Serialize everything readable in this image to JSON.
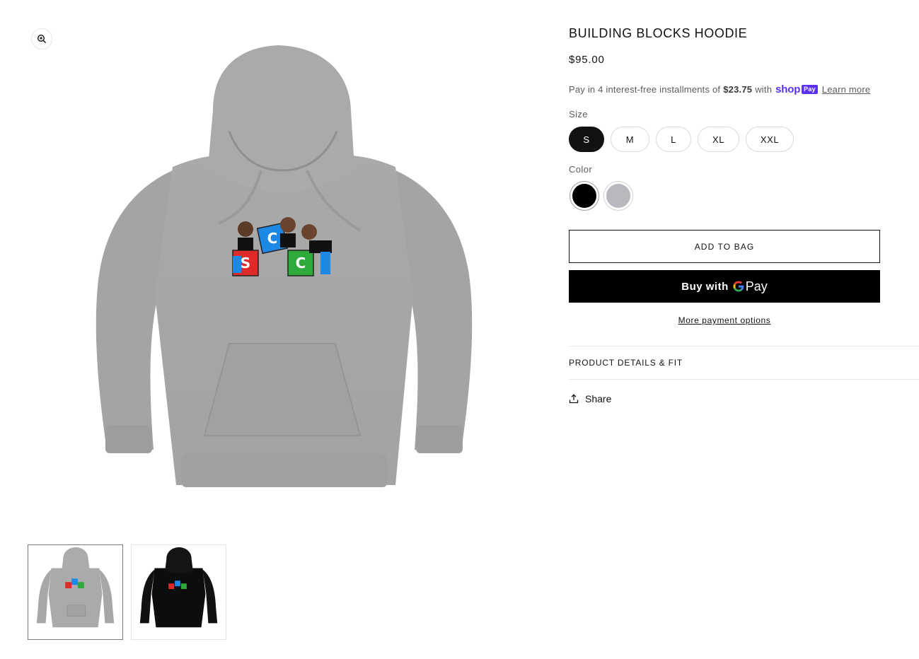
{
  "product": {
    "title": "BUILDING BLOCKS HOODIE",
    "price": "$95.00"
  },
  "installments": {
    "prefix": "Pay in 4 interest-free installments of",
    "amount": "$23.75",
    "with_text": "with",
    "shop_word": "shop",
    "pay_word": "Pay",
    "learn_more": "Learn more"
  },
  "options": {
    "size_label": "Size",
    "sizes": [
      "S",
      "M",
      "L",
      "XL",
      "XXL"
    ],
    "selected_size": "S",
    "color_label": "Color",
    "colors": [
      {
        "name": "black",
        "hex": "#000000"
      },
      {
        "name": "gray",
        "hex": "#B8B8BE"
      }
    ]
  },
  "design_letters": [
    "C",
    "C",
    "S",
    "C"
  ],
  "buttons": {
    "add_to_bag": "ADD TO BAG",
    "buy_with": "Buy with",
    "gpay_g": "G",
    "gpay_pay": "Pay",
    "more_payment_options": "More payment options"
  },
  "accordion": {
    "details_label": "PRODUCT DETAILS & FIT"
  },
  "share_label": "Share",
  "colors": {
    "text": "#121212",
    "muted": "#5c5c5c",
    "shop_pay_purple": "#5a31f4",
    "hoodie_gray": "#a8a8a8"
  },
  "icons": [
    "zoom-icon",
    "share-icon",
    "shop-pay-logo",
    "google-g-logo"
  ]
}
